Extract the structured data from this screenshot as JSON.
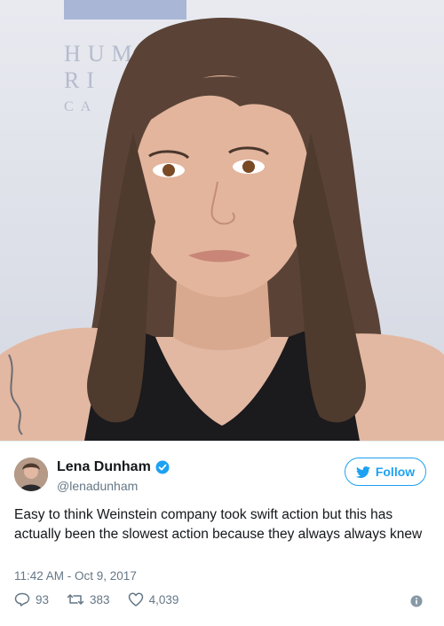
{
  "photo": {
    "backdrop_lines": [
      "HUM",
      "RI",
      "CA"
    ]
  },
  "tweet": {
    "display_name": "Lena Dunham",
    "handle": "@lenadunham",
    "follow_label": "Follow",
    "text": "Easy to think Weinstein company took swift action but this has actually been the slowest action because they always always knew",
    "timestamp": "11:42 AM - Oct 9, 2017",
    "replies": "93",
    "retweets": "383",
    "likes": "4,039",
    "accent_color": "#1da1f2"
  }
}
